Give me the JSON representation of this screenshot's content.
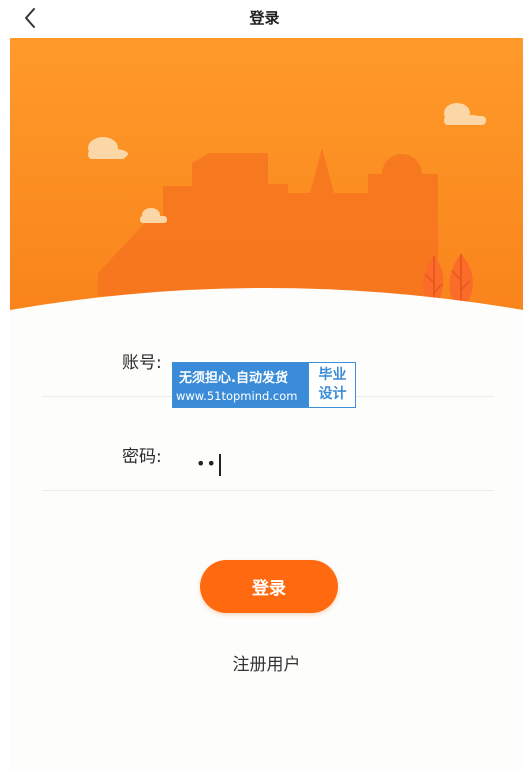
{
  "nav": {
    "title": "登录"
  },
  "form": {
    "account_label": "账号:",
    "account_value": "",
    "password_label": "密码:",
    "password_value": "••"
  },
  "buttons": {
    "login_label": "登录",
    "register_label": "注册用户"
  },
  "watermark": {
    "line1": "无须担心.自动发货",
    "line2": "www.51topmind.com",
    "side_line1": "毕业",
    "side_line2": "设计"
  },
  "colors": {
    "accent": "#ff6a10",
    "hero_orange": "#fb8a1e",
    "hero_light": "#ff9a2a",
    "watermark_blue": "#3b8cd8"
  }
}
